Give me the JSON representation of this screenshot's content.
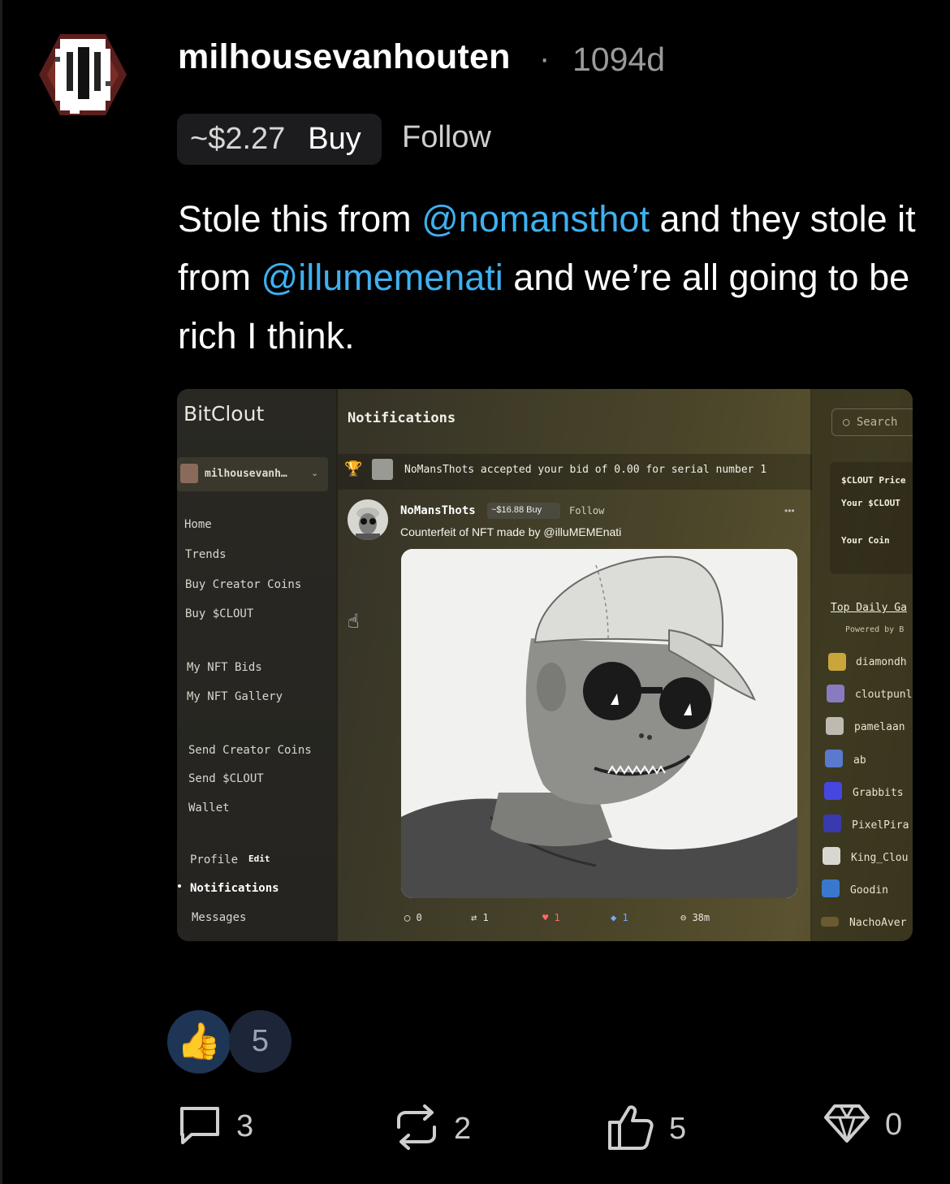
{
  "post": {
    "username": "milhousevanhouten",
    "separator": "·",
    "age": "1094d",
    "coin_price": "~$2.27",
    "buy_label": "Buy",
    "follow_label": "Follow",
    "text_parts": {
      "p1": "Stole this from ",
      "m1": "@nomansthot",
      "p2": " and they stole it from ",
      "m2": "@illumemenati",
      "p3": " and we’re all going to be rich I think."
    }
  },
  "embedded_image": {
    "brand": "BitClout",
    "user": "milhousevanh…",
    "nav": [
      "Home",
      "Trends",
      "Buy Creator Coins",
      "Buy $CLOUT",
      "My NFT Bids",
      "My NFT Gallery",
      "Send Creator Coins",
      "Send $CLOUT",
      "Wallet",
      "Profile",
      "Notifications",
      "Messages"
    ],
    "edit_label": "Edit",
    "page_title": "Notifications",
    "notification": "NoMansThots accepted your bid of 0.00 for serial number 1",
    "post_name": "NoMansThots",
    "post_price": "~$16.88 Buy",
    "post_follow": "Follow",
    "post_more": "•••",
    "post_caption": "Counterfeit of NFT made by @illuMEMEnati",
    "stats": {
      "comments": "0",
      "reclouts": "1",
      "likes": "1",
      "diamonds": "1",
      "time": "38m"
    },
    "search_placeholder": "Search",
    "right_card": [
      "$CLOUT Price",
      "Your $CLOUT",
      "Your Coin"
    ],
    "right_heading": "Top Daily Ga",
    "right_powered": "Powered by B",
    "right_items": [
      "diamondh",
      "cloutpunl",
      "pamelaan",
      "ab",
      "Grabbits",
      "PixelPira",
      "King_Clou",
      "Goodin",
      "NachoAver"
    ]
  },
  "reactions": {
    "emoji": "👍",
    "count": "5"
  },
  "actions": {
    "comments": "3",
    "reposts": "2",
    "likes": "5",
    "diamonds": "0"
  },
  "colors": {
    "mention": "#3fb0ef",
    "background": "#000000",
    "reaction_pill": "#1e3556"
  }
}
